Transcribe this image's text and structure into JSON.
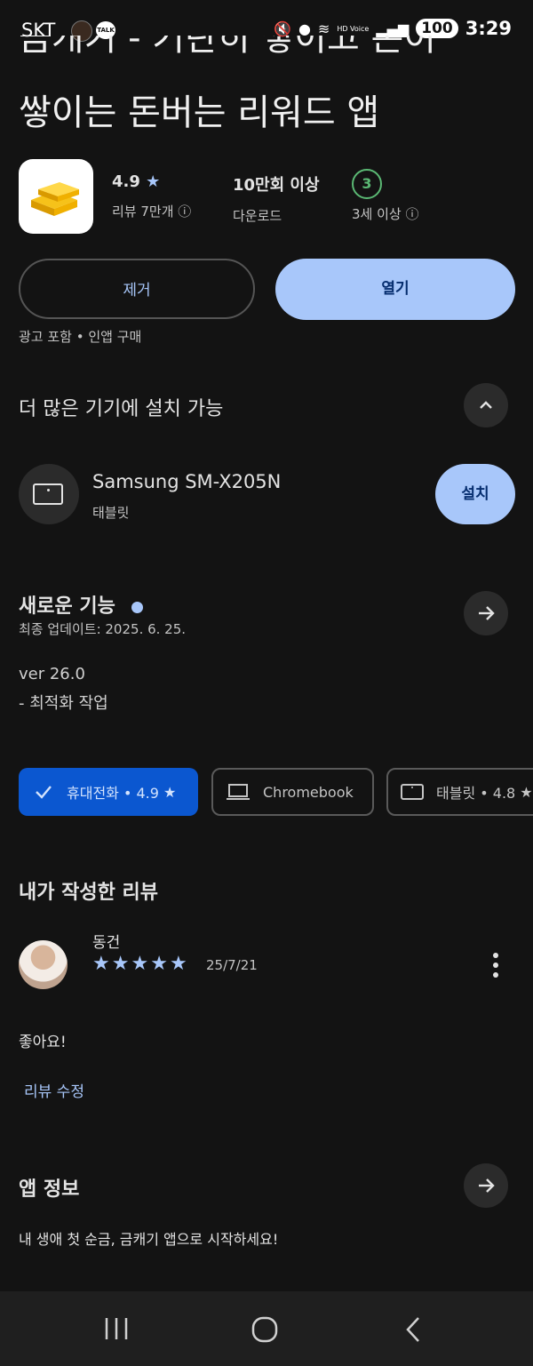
{
  "status_bar": {
    "carrier": "SKT",
    "talk_icon_text": "TALK",
    "battery": "100",
    "time": "3:29",
    "hd_voice": "HD Voice"
  },
  "app": {
    "title_line1_partial": "금캐기 - 기란히 쌓이고 돈이",
    "title_line2": "쌓이는 돈버는 리워드 앱",
    "rating_value": "4.9",
    "rating_label": "리뷰 7만개",
    "downloads_value": "10만회 이상",
    "downloads_label": "다운로드",
    "age_value": "3",
    "age_label": "3세 이상"
  },
  "actions": {
    "uninstall_label": "제거",
    "open_label": "열기",
    "note": "광고 포함 • 인앱 구매"
  },
  "more_devices": {
    "heading": "더 많은 기기에 설치 가능",
    "device_name": "Samsung SM-X205N",
    "device_type": "태블릿",
    "install_label": "설치"
  },
  "whats_new": {
    "heading": "새로운 기능",
    "updated": "최종 업데이트: 2025. 6. 25.",
    "version": "ver 26.0",
    "change": "- 최적화 작업"
  },
  "device_chips": [
    {
      "label": "휴대전화 • 4.9",
      "selected": true
    },
    {
      "label": "Chromebook",
      "selected": false
    },
    {
      "label": "태블릿 • 4.8",
      "selected": false
    }
  ],
  "my_review": {
    "heading": "내가 작성한 리뷰",
    "author": "동건",
    "stars": 5,
    "date": "25/7/21",
    "text": "좋아요!",
    "edit_label": "리뷰 수정"
  },
  "about": {
    "heading": "앱 정보",
    "description": "내 생애 첫 순금, 금캐기 앱으로 시작하세요!"
  },
  "colors": {
    "background": "#131313",
    "accent": "#a8c7fa",
    "selected_chip": "#0b57d0"
  }
}
